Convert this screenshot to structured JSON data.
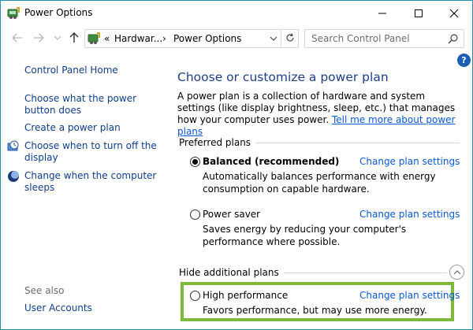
{
  "window": {
    "title": "Power Options"
  },
  "address": {
    "prefix": "«",
    "crumb1": "Hardwar...",
    "sep": "›",
    "crumb2": "Power Options"
  },
  "search": {
    "placeholder": "Search Control Panel"
  },
  "sidebar": {
    "items": [
      {
        "label": "Control Panel Home"
      },
      {
        "label": "Choose what the power button does"
      },
      {
        "label": "Create a power plan"
      },
      {
        "label": "Choose when to turn off the display"
      },
      {
        "label": "Change when the computer sleeps"
      }
    ],
    "see_also_label": "See also",
    "see_also_items": [
      {
        "label": "User Accounts"
      }
    ]
  },
  "main": {
    "heading": "Choose or customize a power plan",
    "intro": "A power plan is a collection of hardware and system settings (like display brightness, sleep, etc.) that manages how your computer uses power.",
    "intro_link": "Tell me more about power plans",
    "preferred_label": "Preferred plans",
    "hide_label": "Hide additional plans",
    "plans": [
      {
        "name": "Balanced (recommended)",
        "selected": true,
        "link": "Change plan settings",
        "desc": "Automatically balances performance with energy consumption on capable hardware."
      },
      {
        "name": "Power saver",
        "selected": false,
        "link": "Change plan settings",
        "desc": "Saves energy by reducing your computer's performance where possible."
      },
      {
        "name": "High performance",
        "selected": false,
        "link": "Change plan settings",
        "desc": "Favors performance, but may use more energy."
      }
    ]
  },
  "colors": {
    "link": "#0b57d0",
    "heading": "#1e3f87",
    "highlight": "#7db93a",
    "help": "#1a5fb4"
  }
}
